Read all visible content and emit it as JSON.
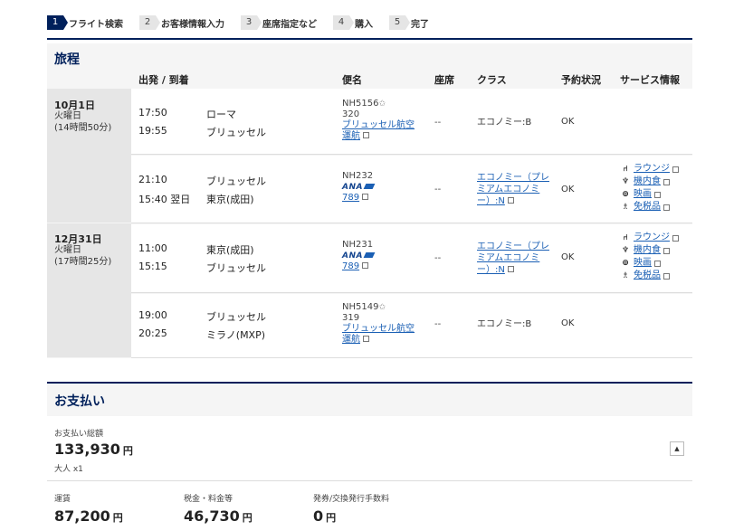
{
  "steps": [
    {
      "num": "1",
      "label": "フライト検索"
    },
    {
      "num": "2",
      "label": "お客様情報入力"
    },
    {
      "num": "3",
      "label": "座席指定など"
    },
    {
      "num": "4",
      "label": "購入"
    },
    {
      "num": "5",
      "label": "完了"
    }
  ],
  "itinerary": {
    "title": "旅程",
    "headers": {
      "dep_arr": "出発 / 到着",
      "flight": "便名",
      "seat": "座席",
      "class": "クラス",
      "status": "予約状況",
      "service": "サービス情報"
    },
    "days": [
      {
        "date": "10月1日",
        "weekday": "火曜日",
        "duration": "(14時間50分)"
      },
      {
        "date": "12月31日",
        "weekday": "火曜日",
        "duration": "(17時間25分)"
      }
    ],
    "segments": [
      {
        "dep_time": "17:50",
        "dep_city": "ローマ",
        "arr_time": "19:55",
        "arr_city": "ブリュッセル",
        "flight_no": "NH5156",
        "aircraft": "320",
        "operator": "ブリュッセル航空",
        "operator2": "運航",
        "seat": "--",
        "class": "エコノミー:B",
        "status": "OK"
      },
      {
        "dep_time": "21:10",
        "dep_city": "ブリュッセル",
        "arr_time": "15:40 翌日",
        "arr_city": "東京(成田)",
        "flight_no": "NH232",
        "airline_logo": "ANA",
        "aircraft_link": "789",
        "seat": "--",
        "class_line1": "エコノミー（プレ",
        "class_line2": "ミアムエコノミ",
        "class_line3": "ー）:N",
        "status": "OK"
      },
      {
        "dep_time": "11:00",
        "dep_city": "東京(成田)",
        "arr_time": "15:15",
        "arr_city": "ブリュッセル",
        "flight_no": "NH231",
        "airline_logo": "ANA",
        "aircraft_link": "789",
        "seat": "--",
        "class_line1": "エコノミー（プレ",
        "class_line2": "ミアムエコノミ",
        "class_line3": "ー）:N",
        "status": "OK"
      },
      {
        "dep_time": "19:00",
        "dep_city": "ブリュッセル",
        "arr_time": "20:25",
        "arr_city": "ミラノ(MXP)",
        "flight_no": "NH5149",
        "aircraft": "319",
        "operator": "ブリュッセル航空",
        "operator2": "運航",
        "seat": "--",
        "class": "エコノミー:B",
        "status": "OK"
      }
    ],
    "services": [
      {
        "icon": "lounge-icon",
        "label": "ラウンジ"
      },
      {
        "icon": "meal-icon",
        "label": "機内食"
      },
      {
        "icon": "movie-icon",
        "label": "映画"
      },
      {
        "icon": "dutyfree-icon",
        "label": "免税品"
      }
    ]
  },
  "payment": {
    "title": "お支払い",
    "total_label": "お支払い総額",
    "total": "133,930",
    "yen": "円",
    "pax": "大人 x1",
    "fare_label": "運賃",
    "fare": "87,200",
    "tax_label": "税金・料金等",
    "tax": "46,730",
    "fee_label": "発券/交換発行手数料",
    "fee": "0"
  }
}
